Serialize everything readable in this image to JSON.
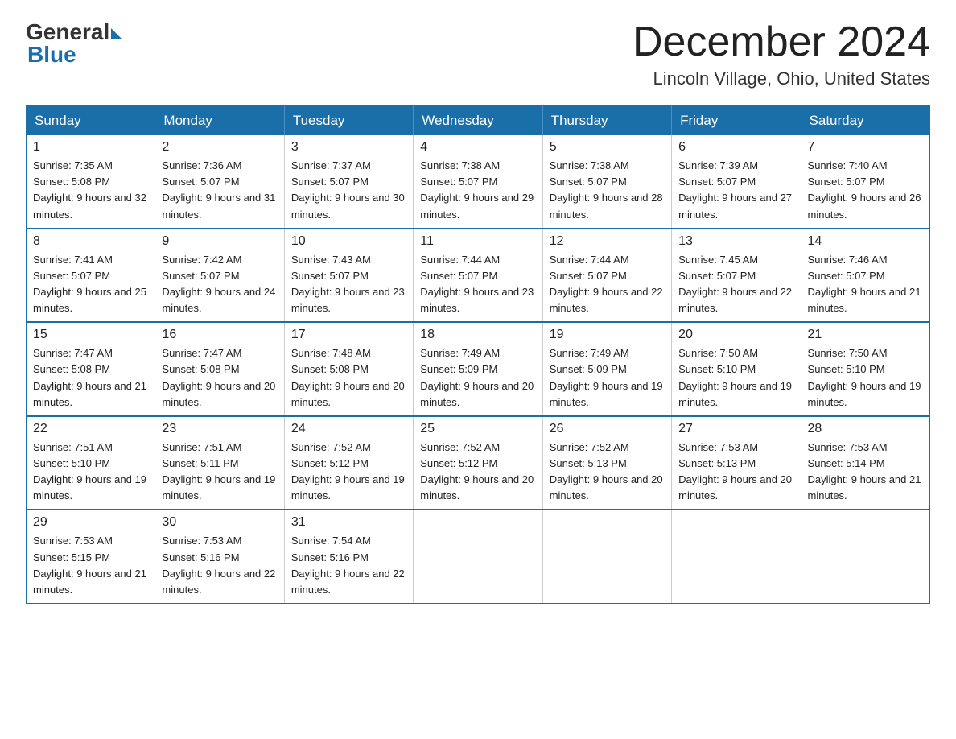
{
  "header": {
    "logo_general": "General",
    "logo_blue": "Blue",
    "title": "December 2024",
    "subtitle": "Lincoln Village, Ohio, United States"
  },
  "days_of_week": [
    "Sunday",
    "Monday",
    "Tuesday",
    "Wednesday",
    "Thursday",
    "Friday",
    "Saturday"
  ],
  "weeks": [
    [
      {
        "day": "1",
        "sunrise": "7:35 AM",
        "sunset": "5:08 PM",
        "daylight": "9 hours and 32 minutes."
      },
      {
        "day": "2",
        "sunrise": "7:36 AM",
        "sunset": "5:07 PM",
        "daylight": "9 hours and 31 minutes."
      },
      {
        "day": "3",
        "sunrise": "7:37 AM",
        "sunset": "5:07 PM",
        "daylight": "9 hours and 30 minutes."
      },
      {
        "day": "4",
        "sunrise": "7:38 AM",
        "sunset": "5:07 PM",
        "daylight": "9 hours and 29 minutes."
      },
      {
        "day": "5",
        "sunrise": "7:38 AM",
        "sunset": "5:07 PM",
        "daylight": "9 hours and 28 minutes."
      },
      {
        "day": "6",
        "sunrise": "7:39 AM",
        "sunset": "5:07 PM",
        "daylight": "9 hours and 27 minutes."
      },
      {
        "day": "7",
        "sunrise": "7:40 AM",
        "sunset": "5:07 PM",
        "daylight": "9 hours and 26 minutes."
      }
    ],
    [
      {
        "day": "8",
        "sunrise": "7:41 AM",
        "sunset": "5:07 PM",
        "daylight": "9 hours and 25 minutes."
      },
      {
        "day": "9",
        "sunrise": "7:42 AM",
        "sunset": "5:07 PM",
        "daylight": "9 hours and 24 minutes."
      },
      {
        "day": "10",
        "sunrise": "7:43 AM",
        "sunset": "5:07 PM",
        "daylight": "9 hours and 23 minutes."
      },
      {
        "day": "11",
        "sunrise": "7:44 AM",
        "sunset": "5:07 PM",
        "daylight": "9 hours and 23 minutes."
      },
      {
        "day": "12",
        "sunrise": "7:44 AM",
        "sunset": "5:07 PM",
        "daylight": "9 hours and 22 minutes."
      },
      {
        "day": "13",
        "sunrise": "7:45 AM",
        "sunset": "5:07 PM",
        "daylight": "9 hours and 22 minutes."
      },
      {
        "day": "14",
        "sunrise": "7:46 AM",
        "sunset": "5:07 PM",
        "daylight": "9 hours and 21 minutes."
      }
    ],
    [
      {
        "day": "15",
        "sunrise": "7:47 AM",
        "sunset": "5:08 PM",
        "daylight": "9 hours and 21 minutes."
      },
      {
        "day": "16",
        "sunrise": "7:47 AM",
        "sunset": "5:08 PM",
        "daylight": "9 hours and 20 minutes."
      },
      {
        "day": "17",
        "sunrise": "7:48 AM",
        "sunset": "5:08 PM",
        "daylight": "9 hours and 20 minutes."
      },
      {
        "day": "18",
        "sunrise": "7:49 AM",
        "sunset": "5:09 PM",
        "daylight": "9 hours and 20 minutes."
      },
      {
        "day": "19",
        "sunrise": "7:49 AM",
        "sunset": "5:09 PM",
        "daylight": "9 hours and 19 minutes."
      },
      {
        "day": "20",
        "sunrise": "7:50 AM",
        "sunset": "5:10 PM",
        "daylight": "9 hours and 19 minutes."
      },
      {
        "day": "21",
        "sunrise": "7:50 AM",
        "sunset": "5:10 PM",
        "daylight": "9 hours and 19 minutes."
      }
    ],
    [
      {
        "day": "22",
        "sunrise": "7:51 AM",
        "sunset": "5:10 PM",
        "daylight": "9 hours and 19 minutes."
      },
      {
        "day": "23",
        "sunrise": "7:51 AM",
        "sunset": "5:11 PM",
        "daylight": "9 hours and 19 minutes."
      },
      {
        "day": "24",
        "sunrise": "7:52 AM",
        "sunset": "5:12 PM",
        "daylight": "9 hours and 19 minutes."
      },
      {
        "day": "25",
        "sunrise": "7:52 AM",
        "sunset": "5:12 PM",
        "daylight": "9 hours and 20 minutes."
      },
      {
        "day": "26",
        "sunrise": "7:52 AM",
        "sunset": "5:13 PM",
        "daylight": "9 hours and 20 minutes."
      },
      {
        "day": "27",
        "sunrise": "7:53 AM",
        "sunset": "5:13 PM",
        "daylight": "9 hours and 20 minutes."
      },
      {
        "day": "28",
        "sunrise": "7:53 AM",
        "sunset": "5:14 PM",
        "daylight": "9 hours and 21 minutes."
      }
    ],
    [
      {
        "day": "29",
        "sunrise": "7:53 AM",
        "sunset": "5:15 PM",
        "daylight": "9 hours and 21 minutes."
      },
      {
        "day": "30",
        "sunrise": "7:53 AM",
        "sunset": "5:16 PM",
        "daylight": "9 hours and 22 minutes."
      },
      {
        "day": "31",
        "sunrise": "7:54 AM",
        "sunset": "5:16 PM",
        "daylight": "9 hours and 22 minutes."
      },
      null,
      null,
      null,
      null
    ]
  ]
}
